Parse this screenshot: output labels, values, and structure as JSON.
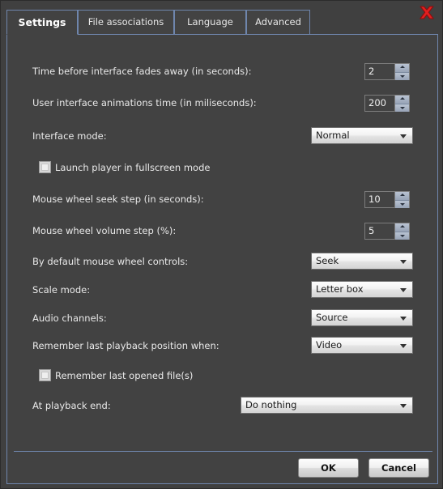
{
  "window": {
    "close_icon": "close-x-icon",
    "close_color": "#e02020",
    "accent_color": "#6f86ad",
    "background_color": "#424242",
    "text_color": "#e9e9e9"
  },
  "tabs": [
    {
      "label": "Settings",
      "active": true
    },
    {
      "label": "File associations",
      "active": false
    },
    {
      "label": "Language",
      "active": false
    },
    {
      "label": "Advanced",
      "active": false
    }
  ],
  "settings": {
    "rows": [
      {
        "type": "spinner",
        "label": "Time before interface fades away (in seconds):",
        "value": "2"
      },
      {
        "type": "spinner",
        "label": "User interface animations time  (in miliseconds):",
        "value": "200"
      },
      {
        "type": "combo",
        "label": "Interface mode:",
        "value": "Normal"
      },
      {
        "type": "checkbox",
        "label": "Launch player in fullscreen mode",
        "checked": false
      },
      {
        "type": "spinner",
        "label": "Mouse wheel seek step (in seconds):",
        "value": "10"
      },
      {
        "type": "spinner",
        "label": "Mouse wheel volume step (%):",
        "value": "5"
      },
      {
        "type": "combo",
        "label": "By default mouse wheel controls:",
        "value": "Seek"
      },
      {
        "type": "combo",
        "label": "Scale mode:",
        "value": "Letter box"
      },
      {
        "type": "combo",
        "label": "Audio channels:",
        "value": "Source"
      },
      {
        "type": "combo",
        "label": "Remember last playback position when:",
        "value": "Video"
      },
      {
        "type": "checkbox",
        "label": "Remember last opened file(s)",
        "checked": false
      },
      {
        "type": "combo",
        "label": "At playback end:",
        "value": "Do nothing"
      }
    ]
  },
  "buttons": {
    "ok_label": "OK",
    "cancel_label": "Cancel"
  }
}
